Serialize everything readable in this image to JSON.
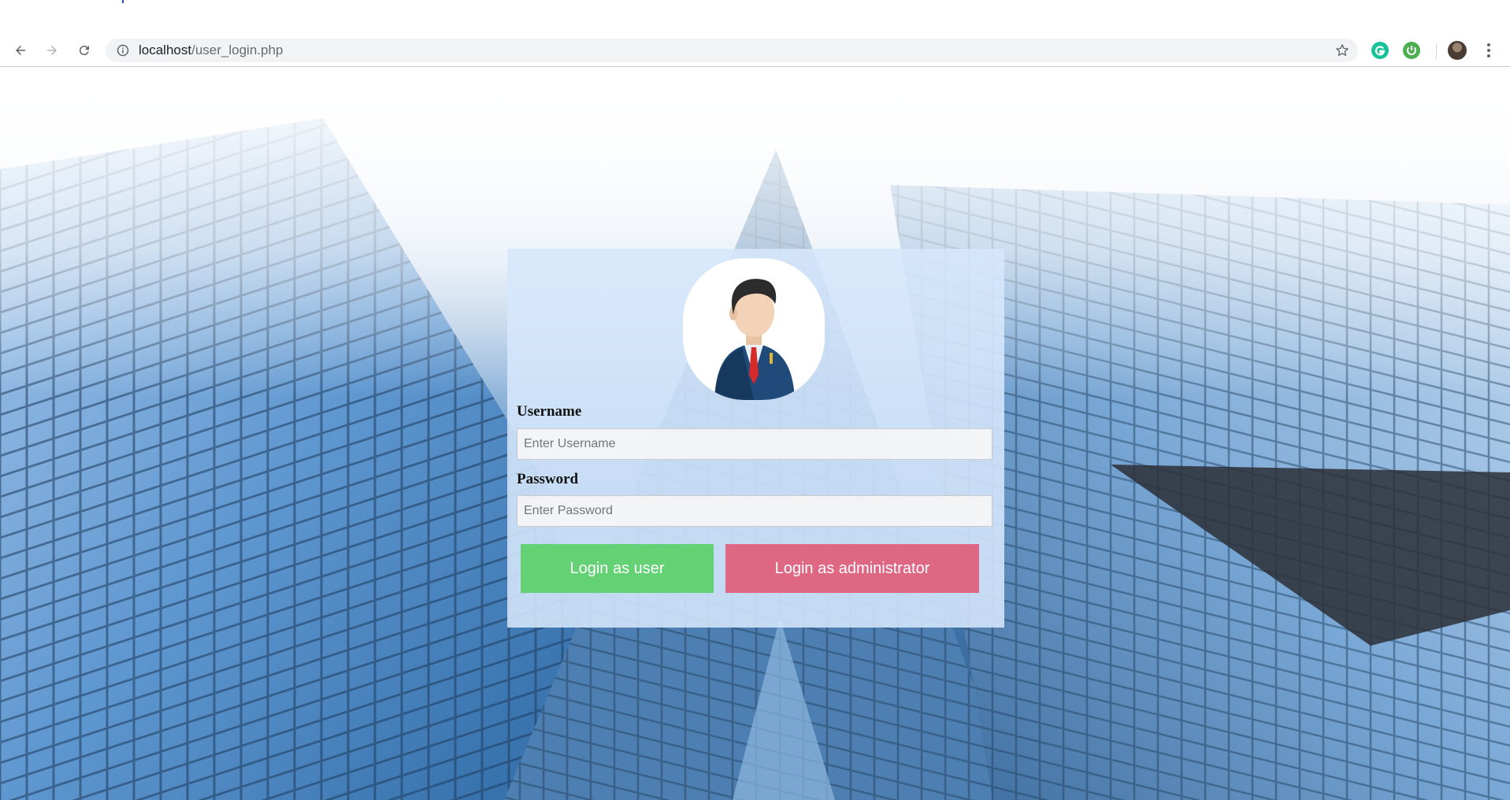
{
  "browser": {
    "url_host": "localhost",
    "url_path": "/user_login.php",
    "nav_icons": [
      "back-arrow-icon",
      "forward-arrow-icon",
      "reload-icon"
    ],
    "omnibox_icons": [
      "info-icon",
      "bookmark-star-icon"
    ],
    "extension_icons": [
      "grammarly-icon",
      "extension-green-icon"
    ],
    "colors": {
      "toolbar_bg": "#ffffff",
      "omnibox_bg": "#f1f3f4",
      "url_path": "#6b6b6b"
    }
  },
  "login": {
    "avatar_icon": "businessman-avatar-icon",
    "username_label": "Username",
    "username_placeholder": "Enter Username",
    "username_value": "",
    "password_label": "Password",
    "password_placeholder": "Enter Password",
    "password_value": "",
    "user_button_label": "Login as user",
    "admin_button_label": "Login as administrator",
    "colors": {
      "card_bg": "#d6e7fc",
      "user_button": "#63d174",
      "admin_button": "#de6784"
    }
  },
  "background": {
    "description_icon": "glass-skyscraper-background"
  }
}
